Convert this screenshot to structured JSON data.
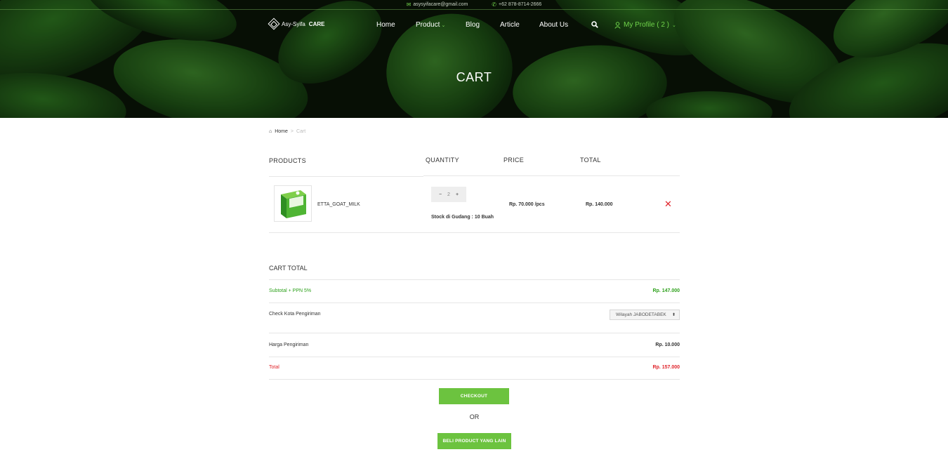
{
  "topbar": {
    "email": "asysyifacare@gmail.com",
    "phone": "+62 878-8714-2666"
  },
  "nav": {
    "logo_text": "Asy-Syifa",
    "logo_bold": "CARE",
    "items": [
      "Home",
      "Product",
      "Blog",
      "Article",
      "About Us"
    ],
    "profile": "My Profile ( 2 )"
  },
  "hero": {
    "title": "CART"
  },
  "breadcrumb": {
    "home": "Home",
    "sep": ">",
    "current": "Cart"
  },
  "table": {
    "headers": [
      "PRODUCTS",
      "QUANTITY",
      "PRICE",
      "TOTAL"
    ],
    "item": {
      "name": "ETTA_GOAT_MILK",
      "qty_minus": "−",
      "qty": "2",
      "qty_plus": "+",
      "stock": "Stock di Gudang : 10 Buah",
      "price": "Rp. 70.000 /pcs",
      "total": "Rp. 140.000"
    }
  },
  "cart_total": {
    "title": "CART TOTAL",
    "subtotal_label": "Subtotal + PPN 5%",
    "subtotal_value": "Rp. 147.000",
    "city_label": "Check Kota Pengiriman",
    "city_selected": "Wilayah JABODETABEK",
    "shipping_label": "Harga Pengiriman",
    "shipping_value": "Rp. 10.000",
    "total_label": "Total",
    "total_value": "Rp. 157.000"
  },
  "actions": {
    "checkout": "CHECKOUT",
    "or": "OR",
    "other": "BELI PRODUCT YANG LAIN"
  },
  "colors": {
    "accent": "#6cc33f",
    "success": "#2ea11c",
    "danger": "#e0242b"
  }
}
